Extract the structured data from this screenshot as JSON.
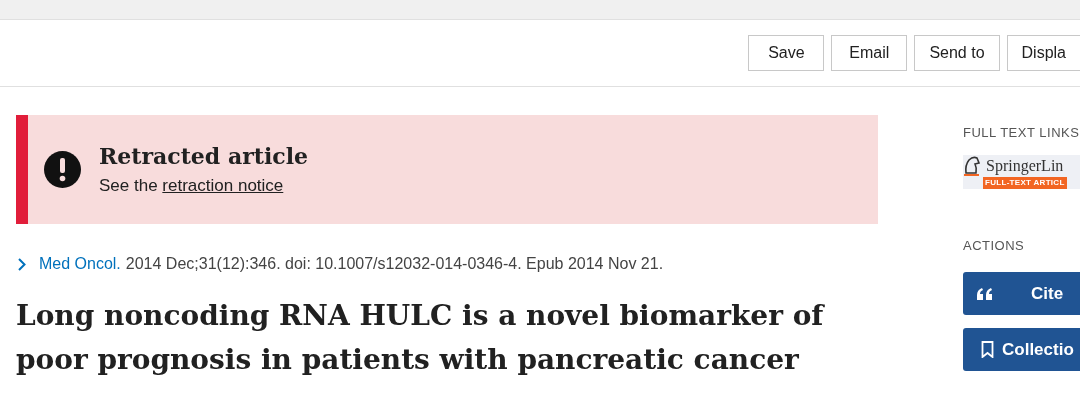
{
  "toolbar": {
    "buttons": [
      "Save",
      "Email",
      "Send to",
      "Displa"
    ]
  },
  "retraction_banner": {
    "title": "Retracted article",
    "text": "See the",
    "link": "retraction notice"
  },
  "citation": {
    "journal": "Med Oncol.",
    "details": "2014 Dec;31(12):346. doi: 10.1007/s12032-014-0346-4. Epub 2014 Nov 21."
  },
  "article_title": "Long noncoding RNA HULC is a novel biomarker of poor prognosis in patients with pancreatic cancer",
  "sidebar": {
    "full_text_heading": "FULL TEXT LINKS",
    "publisher_logo": {
      "name": "SpringerLin",
      "tagline": "FULL-TEXT ARTICL"
    },
    "actions_heading": "ACTIONS",
    "actions": [
      {
        "kind": "cite",
        "label": "Cite"
      },
      {
        "kind": "collections",
        "label": "Collectio"
      }
    ]
  }
}
